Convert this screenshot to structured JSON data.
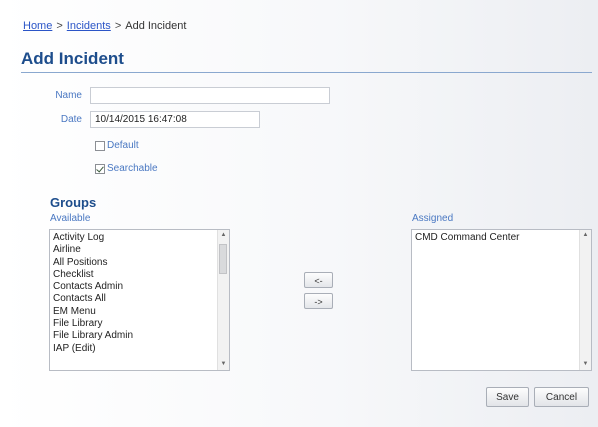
{
  "breadcrumb": {
    "items": [
      {
        "label": "Home"
      },
      {
        "label": "Incidents"
      }
    ],
    "current": "Add Incident",
    "separator": ">"
  },
  "page": {
    "title": "Add Incident"
  },
  "form": {
    "name_label": "Name",
    "name_value": "",
    "date_label": "Date",
    "date_value": "10/14/2015 16:47:08",
    "default_label": "Default",
    "default_checked": false,
    "searchable_label": "Searchable",
    "searchable_checked": true
  },
  "groups": {
    "heading": "Groups",
    "available_label": "Available",
    "assigned_label": "Assigned",
    "available": [
      "Activity Log",
      "Airline",
      "All Positions",
      "Checklist",
      "Contacts Admin",
      "Contacts All",
      "EM Menu",
      "File Library",
      "File Library Admin",
      "IAP (Edit)"
    ],
    "assigned": [
      "CMD Command Center"
    ],
    "add_label": "<-",
    "remove_label": "->"
  },
  "actions": {
    "save_label": "Save",
    "cancel_label": "Cancel"
  }
}
